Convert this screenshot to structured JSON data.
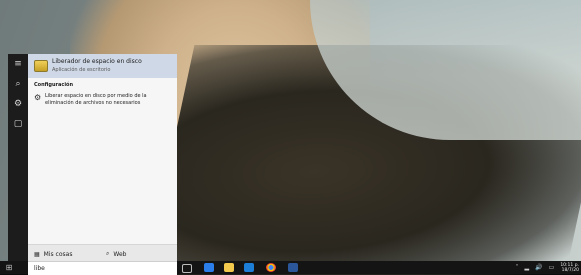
{
  "start_rail": {
    "icons": [
      "hamburger-icon",
      "search-icon",
      "settings-icon",
      "feedback-icon"
    ],
    "glyphs": [
      "≡",
      "⌕",
      "⚙",
      "▢"
    ]
  },
  "search_results": {
    "best_match": {
      "title": "Liberador de espacio en disco",
      "subtitle": "Aplicación de escritorio"
    },
    "section_title": "Configuración",
    "settings": [
      {
        "text": "Liberar espacio en disco por medio de la eliminación de archivos no necesarios",
        "icon": "gear-icon"
      }
    ]
  },
  "scope": {
    "mine_label": "Mis cosas",
    "web_label": "Web",
    "mine_glyph": "▦",
    "web_glyph": "⌕"
  },
  "search_box": {
    "value": "libe"
  },
  "taskbar": {
    "start_glyph": "⊞",
    "pinned": [
      "task-view-icon",
      "edge-icon",
      "file-explorer-icon",
      "store-icon",
      "chrome-icon",
      "word-icon"
    ]
  },
  "tray": {
    "chevron": "˄",
    "net_glyph": "▂",
    "vol_glyph": "🔊",
    "kbd_glyph": "▭",
    "time": "10:11 p.",
    "date": "18/7/20"
  }
}
